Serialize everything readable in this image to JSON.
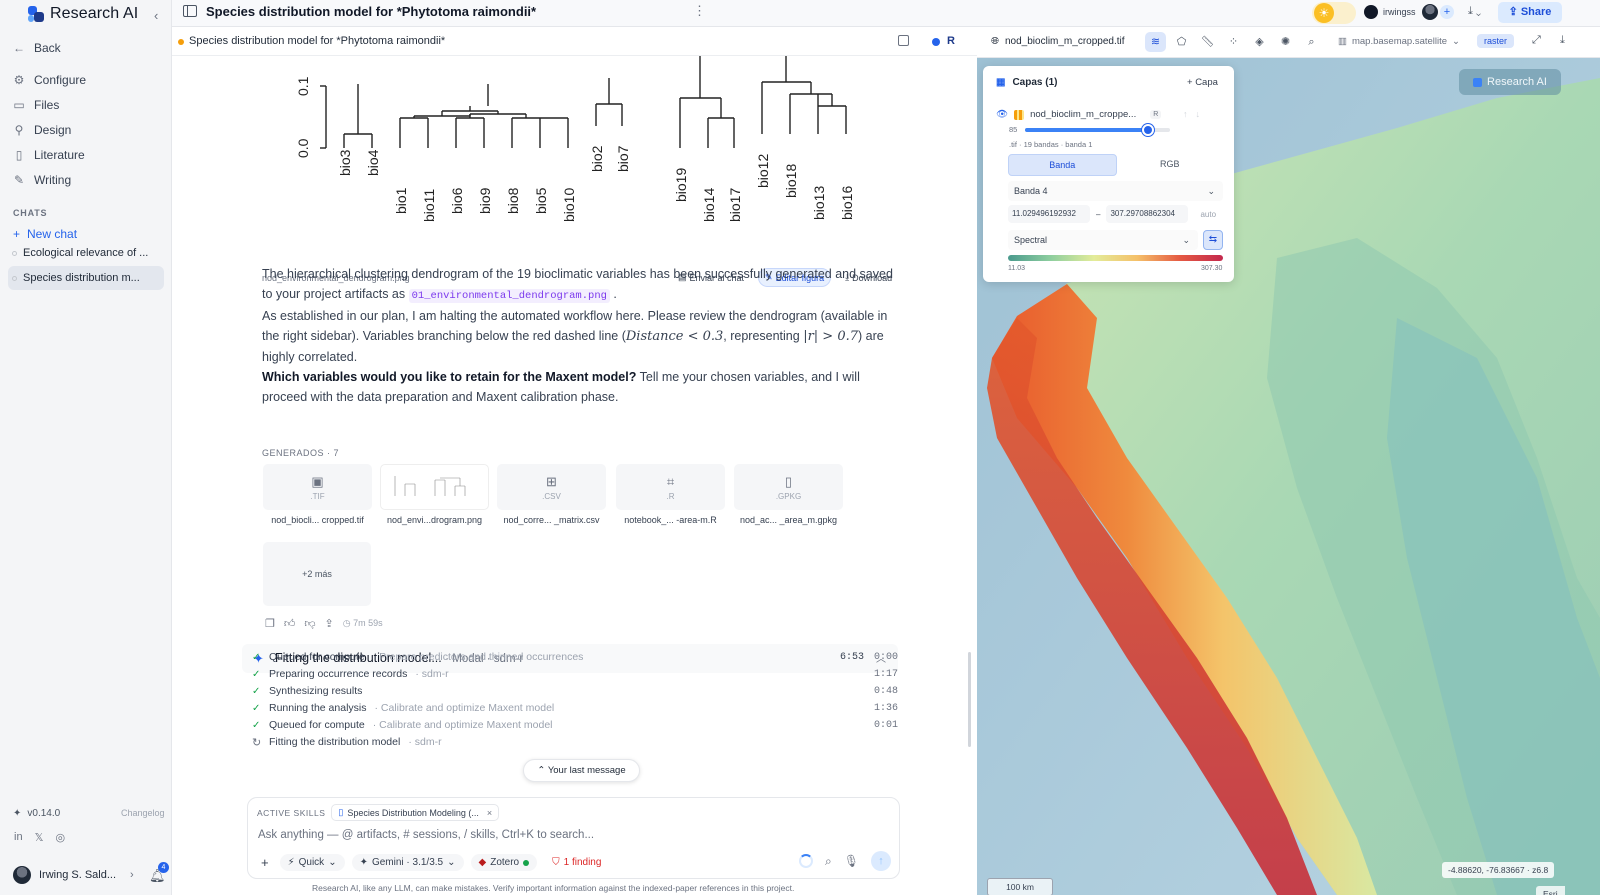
{
  "app": {
    "name": "Research AI",
    "brand_colors": {
      "primary": "#2563eb",
      "dark": "#1e3a8a",
      "light": "#60a5fa"
    }
  },
  "sidebar": {
    "back_label": "Back",
    "nav": [
      {
        "label": "Configure",
        "icon": "gear-icon"
      },
      {
        "label": "Files",
        "icon": "folder-icon"
      },
      {
        "label": "Design",
        "icon": "person-icon"
      },
      {
        "label": "Literature",
        "icon": "book-icon"
      },
      {
        "label": "Writing",
        "icon": "pen-icon"
      }
    ],
    "chats_heading": "CHATS",
    "new_chat_label": "New chat",
    "chats": [
      {
        "label": "Ecological relevance of ...",
        "active": false
      },
      {
        "label": "Species distribution m...",
        "active": true
      }
    ],
    "version": "v0.14.0",
    "changelog_label": "Changelog",
    "user_name": "Irwing S. Sald...",
    "notification_count": "4"
  },
  "topbar": {
    "title": "Species distribution model for *Phytotoma raimondii*",
    "github_user": "irwingss",
    "share_label": "Share"
  },
  "chat": {
    "tab_title": "Species distribution model for *Phytotoma raimondii*",
    "dendrogram": {
      "y_ticks": [
        "0.1",
        "0.0"
      ],
      "leaves": [
        "bio3",
        "bio4",
        "bio1",
        "bio11",
        "bio6",
        "bio9",
        "bio8",
        "bio5",
        "bio10",
        "bio2",
        "bio7",
        "bio19",
        "bio14",
        "bio17",
        "bio12",
        "bio18",
        "bio13",
        "bio16"
      ]
    },
    "figure_caption": "nod_environmental_dendrogram.png",
    "figure_actions": {
      "send": "Enviar al chat",
      "edit": "Editar figura",
      "download": "Download"
    },
    "para1_text": "The hierarchical clustering dendrogram of the 19 bioclimatic variables has been successfully generated and saved to your project artifacts as",
    "para1_code": "01_environmental_dendrogram.png",
    "para2_a": "As established in our plan, I am halting the automated workflow here. Please review the dendrogram (available in the right sidebar). Variables branching below the red dashed line (",
    "para2_math1": "Distance < 0.3",
    "para2_b": ", representing ",
    "para2_math2": "|r| > 0.7",
    "para2_c": ") are highly correlated.",
    "para3_bold": "Which variables would you like to retain for the Maxent model?",
    "para3_rest": " Tell me your chosen variables, and I will proceed with the data preparation and Maxent calibration phase.",
    "generated_heading": "GENERADOS · 7",
    "generated": [
      {
        "ext": ".TIF",
        "name": "nod_biocli... cropped.tif",
        "icon": "image-icon"
      },
      {
        "ext": "",
        "name": "nod_envi...drogram.png",
        "icon": "thumbnail"
      },
      {
        "ext": ".CSV",
        "name": "nod_corre... _matrix.csv",
        "icon": "table-icon"
      },
      {
        "ext": ".R",
        "name": "notebook_... -area-m.R",
        "icon": "code-file-icon"
      },
      {
        "ext": ".GPKG",
        "name": "nod_ac... _area_m.gpkg",
        "icon": "file-icon"
      }
    ],
    "more_label": "+2 más",
    "response_time": "7m 59s",
    "task": {
      "title": "Fitting the distribution model...",
      "sub": "· Modal · sdm-r",
      "elapsed": "6:53",
      "steps": [
        {
          "status": "done",
          "label": "Queued for compute",
          "detail": "· Prepare predictors and thinned occurrences",
          "time": "0:00"
        },
        {
          "status": "done",
          "label": "Preparing occurrence records",
          "detail": "· sdm-r",
          "time": "1:17"
        },
        {
          "status": "done",
          "label": "Synthesizing results",
          "detail": "",
          "time": "0:48"
        },
        {
          "status": "done",
          "label": "Running the analysis",
          "detail": "· Calibrate and optimize Maxent model",
          "time": "1:36"
        },
        {
          "status": "done",
          "label": "Queued for compute",
          "detail": "· Calibrate and optimize Maxent model",
          "time": "0:01"
        },
        {
          "status": "running",
          "label": "Fitting the distribution model",
          "detail": "· sdm-r",
          "time": ""
        }
      ]
    },
    "last_message_label": "Your last message",
    "composer": {
      "skills_heading": "ACTIVE SKILLS",
      "skill": "Species Distribution Modeling (...",
      "placeholder": "Ask anything — @ artifacts, # sessions, / skills, Ctrl+K to search...",
      "mode": "Quick",
      "model": "Gemini · 3.1/3.5",
      "zotero": "Zotero",
      "finding": "1 finding"
    },
    "disclaimer": "Research AI, like any LLM, can make mistakes. Verify important information against the indexed-paper references in this project."
  },
  "map": {
    "file": "nod_bioclim_m_cropped.tif",
    "basemap": "map.basemap.satellite",
    "raster_chip": "raster",
    "brand_badge": "Research AI",
    "layers": {
      "title": "Capas (1)",
      "add_label": "Capa",
      "layer_name": "nod_bioclim_m_croppe...",
      "layer_tag": "R",
      "opacity": 85,
      "meta": ".tif · 19 bandas · banda 1",
      "mode_tabs": [
        "Banda",
        "RGB"
      ],
      "band": "Banda 4",
      "min": "11.029496192932",
      "max": "307.29708862304",
      "auto_label": "auto",
      "ramp": "Spectral",
      "ramp_min": "11.03",
      "ramp_max": "307.30"
    },
    "scale": "100 km",
    "coords": "-4.88620, -76.83667 · z6.8",
    "attribution": "Esri"
  }
}
